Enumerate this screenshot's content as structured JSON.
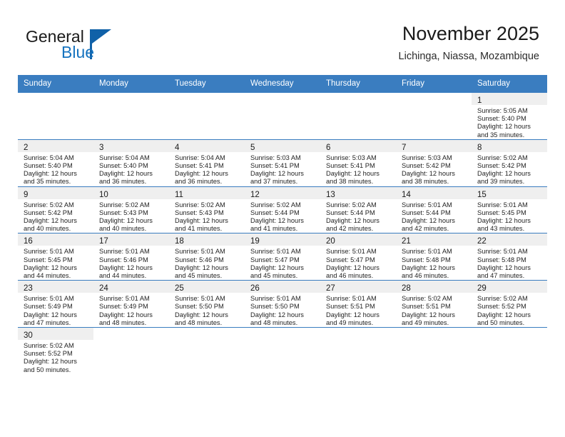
{
  "brand": {
    "name_part1": "General",
    "name_part2": "Blue",
    "flag_icon": "triangle-flag-icon"
  },
  "header": {
    "month_title": "November 2025",
    "location": "Lichinga, Niassa, Mozambique"
  },
  "colors": {
    "header_blue": "#3a7dc0",
    "brand_blue": "#1673bf",
    "daynum_band": "#efefef",
    "text": "#232323"
  },
  "calendar": {
    "weekday_headers": [
      "Sunday",
      "Monday",
      "Tuesday",
      "Wednesday",
      "Thursday",
      "Friday",
      "Saturday"
    ],
    "weeks": [
      [
        {
          "day": "",
          "lines": []
        },
        {
          "day": "",
          "lines": []
        },
        {
          "day": "",
          "lines": []
        },
        {
          "day": "",
          "lines": []
        },
        {
          "day": "",
          "lines": []
        },
        {
          "day": "",
          "lines": []
        },
        {
          "day": "1",
          "lines": [
            "Sunrise: 5:05 AM",
            "Sunset: 5:40 PM",
            "Daylight: 12 hours",
            "and 35 minutes."
          ]
        }
      ],
      [
        {
          "day": "2",
          "lines": [
            "Sunrise: 5:04 AM",
            "Sunset: 5:40 PM",
            "Daylight: 12 hours",
            "and 35 minutes."
          ]
        },
        {
          "day": "3",
          "lines": [
            "Sunrise: 5:04 AM",
            "Sunset: 5:40 PM",
            "Daylight: 12 hours",
            "and 36 minutes."
          ]
        },
        {
          "day": "4",
          "lines": [
            "Sunrise: 5:04 AM",
            "Sunset: 5:41 PM",
            "Daylight: 12 hours",
            "and 36 minutes."
          ]
        },
        {
          "day": "5",
          "lines": [
            "Sunrise: 5:03 AM",
            "Sunset: 5:41 PM",
            "Daylight: 12 hours",
            "and 37 minutes."
          ]
        },
        {
          "day": "6",
          "lines": [
            "Sunrise: 5:03 AM",
            "Sunset: 5:41 PM",
            "Daylight: 12 hours",
            "and 38 minutes."
          ]
        },
        {
          "day": "7",
          "lines": [
            "Sunrise: 5:03 AM",
            "Sunset: 5:42 PM",
            "Daylight: 12 hours",
            "and 38 minutes."
          ]
        },
        {
          "day": "8",
          "lines": [
            "Sunrise: 5:02 AM",
            "Sunset: 5:42 PM",
            "Daylight: 12 hours",
            "and 39 minutes."
          ]
        }
      ],
      [
        {
          "day": "9",
          "lines": [
            "Sunrise: 5:02 AM",
            "Sunset: 5:42 PM",
            "Daylight: 12 hours",
            "and 40 minutes."
          ]
        },
        {
          "day": "10",
          "lines": [
            "Sunrise: 5:02 AM",
            "Sunset: 5:43 PM",
            "Daylight: 12 hours",
            "and 40 minutes."
          ]
        },
        {
          "day": "11",
          "lines": [
            "Sunrise: 5:02 AM",
            "Sunset: 5:43 PM",
            "Daylight: 12 hours",
            "and 41 minutes."
          ]
        },
        {
          "day": "12",
          "lines": [
            "Sunrise: 5:02 AM",
            "Sunset: 5:44 PM",
            "Daylight: 12 hours",
            "and 41 minutes."
          ]
        },
        {
          "day": "13",
          "lines": [
            "Sunrise: 5:02 AM",
            "Sunset: 5:44 PM",
            "Daylight: 12 hours",
            "and 42 minutes."
          ]
        },
        {
          "day": "14",
          "lines": [
            "Sunrise: 5:01 AM",
            "Sunset: 5:44 PM",
            "Daylight: 12 hours",
            "and 42 minutes."
          ]
        },
        {
          "day": "15",
          "lines": [
            "Sunrise: 5:01 AM",
            "Sunset: 5:45 PM",
            "Daylight: 12 hours",
            "and 43 minutes."
          ]
        }
      ],
      [
        {
          "day": "16",
          "lines": [
            "Sunrise: 5:01 AM",
            "Sunset: 5:45 PM",
            "Daylight: 12 hours",
            "and 44 minutes."
          ]
        },
        {
          "day": "17",
          "lines": [
            "Sunrise: 5:01 AM",
            "Sunset: 5:46 PM",
            "Daylight: 12 hours",
            "and 44 minutes."
          ]
        },
        {
          "day": "18",
          "lines": [
            "Sunrise: 5:01 AM",
            "Sunset: 5:46 PM",
            "Daylight: 12 hours",
            "and 45 minutes."
          ]
        },
        {
          "day": "19",
          "lines": [
            "Sunrise: 5:01 AM",
            "Sunset: 5:47 PM",
            "Daylight: 12 hours",
            "and 45 minutes."
          ]
        },
        {
          "day": "20",
          "lines": [
            "Sunrise: 5:01 AM",
            "Sunset: 5:47 PM",
            "Daylight: 12 hours",
            "and 46 minutes."
          ]
        },
        {
          "day": "21",
          "lines": [
            "Sunrise: 5:01 AM",
            "Sunset: 5:48 PM",
            "Daylight: 12 hours",
            "and 46 minutes."
          ]
        },
        {
          "day": "22",
          "lines": [
            "Sunrise: 5:01 AM",
            "Sunset: 5:48 PM",
            "Daylight: 12 hours",
            "and 47 minutes."
          ]
        }
      ],
      [
        {
          "day": "23",
          "lines": [
            "Sunrise: 5:01 AM",
            "Sunset: 5:49 PM",
            "Daylight: 12 hours",
            "and 47 minutes."
          ]
        },
        {
          "day": "24",
          "lines": [
            "Sunrise: 5:01 AM",
            "Sunset: 5:49 PM",
            "Daylight: 12 hours",
            "and 48 minutes."
          ]
        },
        {
          "day": "25",
          "lines": [
            "Sunrise: 5:01 AM",
            "Sunset: 5:50 PM",
            "Daylight: 12 hours",
            "and 48 minutes."
          ]
        },
        {
          "day": "26",
          "lines": [
            "Sunrise: 5:01 AM",
            "Sunset: 5:50 PM",
            "Daylight: 12 hours",
            "and 48 minutes."
          ]
        },
        {
          "day": "27",
          "lines": [
            "Sunrise: 5:01 AM",
            "Sunset: 5:51 PM",
            "Daylight: 12 hours",
            "and 49 minutes."
          ]
        },
        {
          "day": "28",
          "lines": [
            "Sunrise: 5:02 AM",
            "Sunset: 5:51 PM",
            "Daylight: 12 hours",
            "and 49 minutes."
          ]
        },
        {
          "day": "29",
          "lines": [
            "Sunrise: 5:02 AM",
            "Sunset: 5:52 PM",
            "Daylight: 12 hours",
            "and 50 minutes."
          ]
        }
      ],
      [
        {
          "day": "30",
          "lines": [
            "Sunrise: 5:02 AM",
            "Sunset: 5:52 PM",
            "Daylight: 12 hours",
            "and 50 minutes."
          ]
        },
        {
          "day": "",
          "lines": []
        },
        {
          "day": "",
          "lines": []
        },
        {
          "day": "",
          "lines": []
        },
        {
          "day": "",
          "lines": []
        },
        {
          "day": "",
          "lines": []
        },
        {
          "day": "",
          "lines": []
        }
      ]
    ]
  }
}
